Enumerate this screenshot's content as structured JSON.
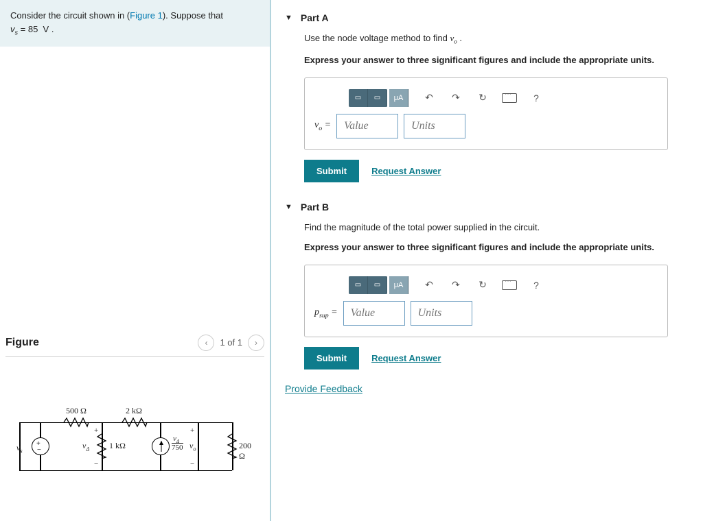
{
  "problem": {
    "text_pre": "Consider the circuit shown in (",
    "figure_link": "Figure 1",
    "text_post": "). Suppose that ",
    "equation_html": "<i>v<sub>s</sub></i> = 85&nbsp;&nbsp;V .",
    "vs_value": 85
  },
  "figure": {
    "title": "Figure",
    "nav_text": "1 of 1",
    "components": {
      "R1": "500 Ω",
      "R2": "2 kΩ",
      "R3": "1 kΩ",
      "R4": "200 Ω",
      "ccvs_ratio": "750",
      "vs_label": "vₛ",
      "vdelta_label": "vΔ",
      "vo_label": "vₒ",
      "vdelta_frac": "vΔ"
    }
  },
  "partA": {
    "title": "Part A",
    "instruction_pre": "Use the node voltage method to find ",
    "instruction_var": "vₒ",
    "instruction_post": " .",
    "bold_instruction": "Express your answer to three significant figures and include the appropriate units.",
    "label_html": "<i>v<sub>o</sub></i> = ",
    "value_placeholder": "Value",
    "units_placeholder": "Units",
    "toolbar_mu": "μA"
  },
  "partB": {
    "title": "Part B",
    "instruction": "Find the magnitude of the total power supplied in the circuit.",
    "bold_instruction": "Express your answer to three significant figures and include the appropriate units.",
    "label_html": "<i>p</i><sub>sup</sub> = ",
    "value_placeholder": "Value",
    "units_placeholder": "Units",
    "toolbar_mu": "μA"
  },
  "buttons": {
    "submit": "Submit",
    "request": "Request Answer",
    "feedback": "Provide Feedback",
    "help": "?"
  }
}
